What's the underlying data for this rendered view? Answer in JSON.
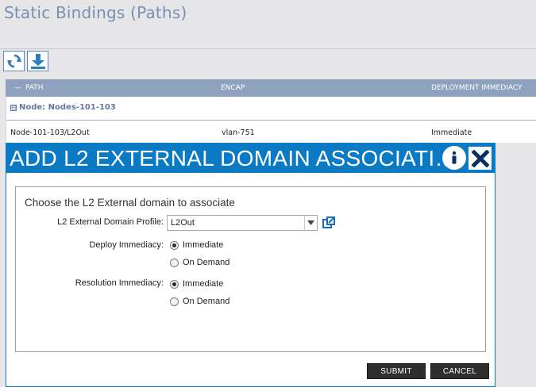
{
  "page": {
    "title": "Static Bindings (Paths)"
  },
  "toolbar": {
    "refresh_icon": "refresh-icon",
    "download_icon": "download-icon"
  },
  "grid": {
    "columns": [
      "PATH",
      "ENCAP",
      "DEPLOYMENT IMMEDIACY"
    ],
    "collapse_marker": "—",
    "group": {
      "expander": "⊟",
      "label": "Node: Nodes-101-103"
    },
    "rows": [
      {
        "path": "Node-101-103/L2Out",
        "encap": "vlan-751",
        "deployment": "Immediate"
      }
    ]
  },
  "dialog": {
    "title": "ADD L2 EXTERNAL DOMAIN ASSOCIATI…",
    "info_icon": "info-icon",
    "close_icon": "close-icon",
    "heading": "Choose the L2 External domain to associate",
    "profile_label": "L2 External Domain Profile:",
    "profile_value": "L2Out",
    "deploy_label": "Deploy Immediacy:",
    "deploy_options": [
      "Immediate",
      "On Demand"
    ],
    "deploy_selected": "Immediate",
    "resolution_label": "Resolution Immediacy:",
    "resolution_options": [
      "Immediate",
      "On Demand"
    ],
    "resolution_selected": "Immediate",
    "submit_label": "SUBMIT",
    "cancel_label": "CANCEL"
  },
  "colors": {
    "accent": "#0a7ac4",
    "header": "#8ea2c0",
    "title_text": "#7a8fb1",
    "button_dark": "#2e2e2e"
  }
}
